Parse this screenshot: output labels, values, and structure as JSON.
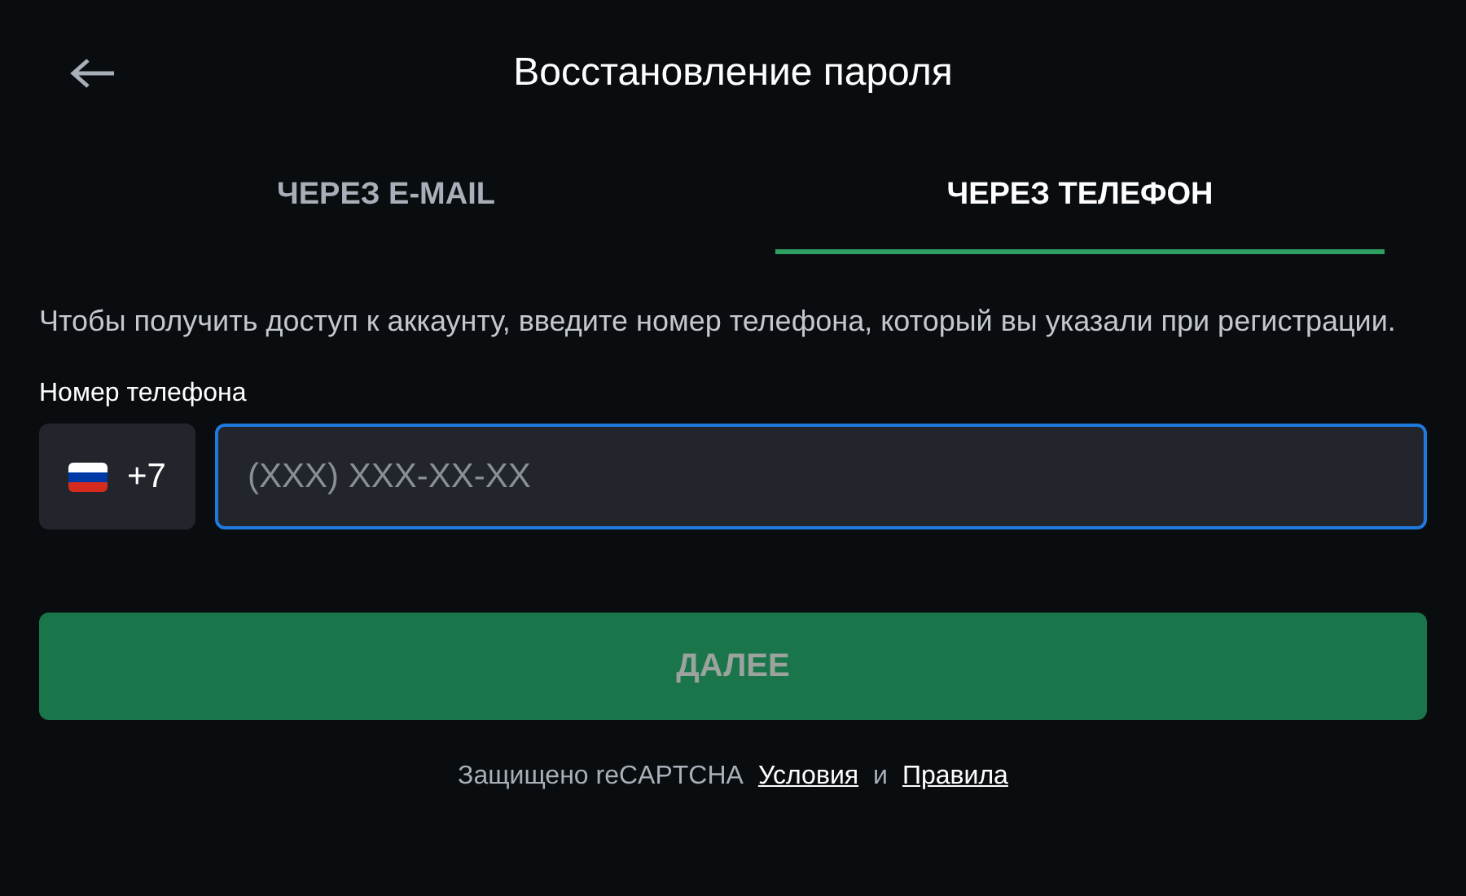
{
  "header": {
    "title": "Восстановление пароля"
  },
  "tabs": [
    {
      "label": "ЧЕРЕЗ E-MAIL",
      "selected": false
    },
    {
      "label": "ЧЕРЕЗ ТЕЛЕФОН",
      "selected": true
    }
  ],
  "description": "Чтобы получить доступ к аккаунту, введите номер телефона, который вы указали при регистрации.",
  "phone": {
    "label": "Номер телефона",
    "country_code": "+7",
    "placeholder": "(XXX) XXX-XX-XX",
    "focused": true
  },
  "submit": {
    "label": "ДАЛЕЕ",
    "disabled": true
  },
  "footer": {
    "text": "Защищено reCAPTCHA",
    "links": [
      {
        "label": "Условия"
      },
      {
        "label": "Правила"
      }
    ],
    "separator": "и"
  }
}
